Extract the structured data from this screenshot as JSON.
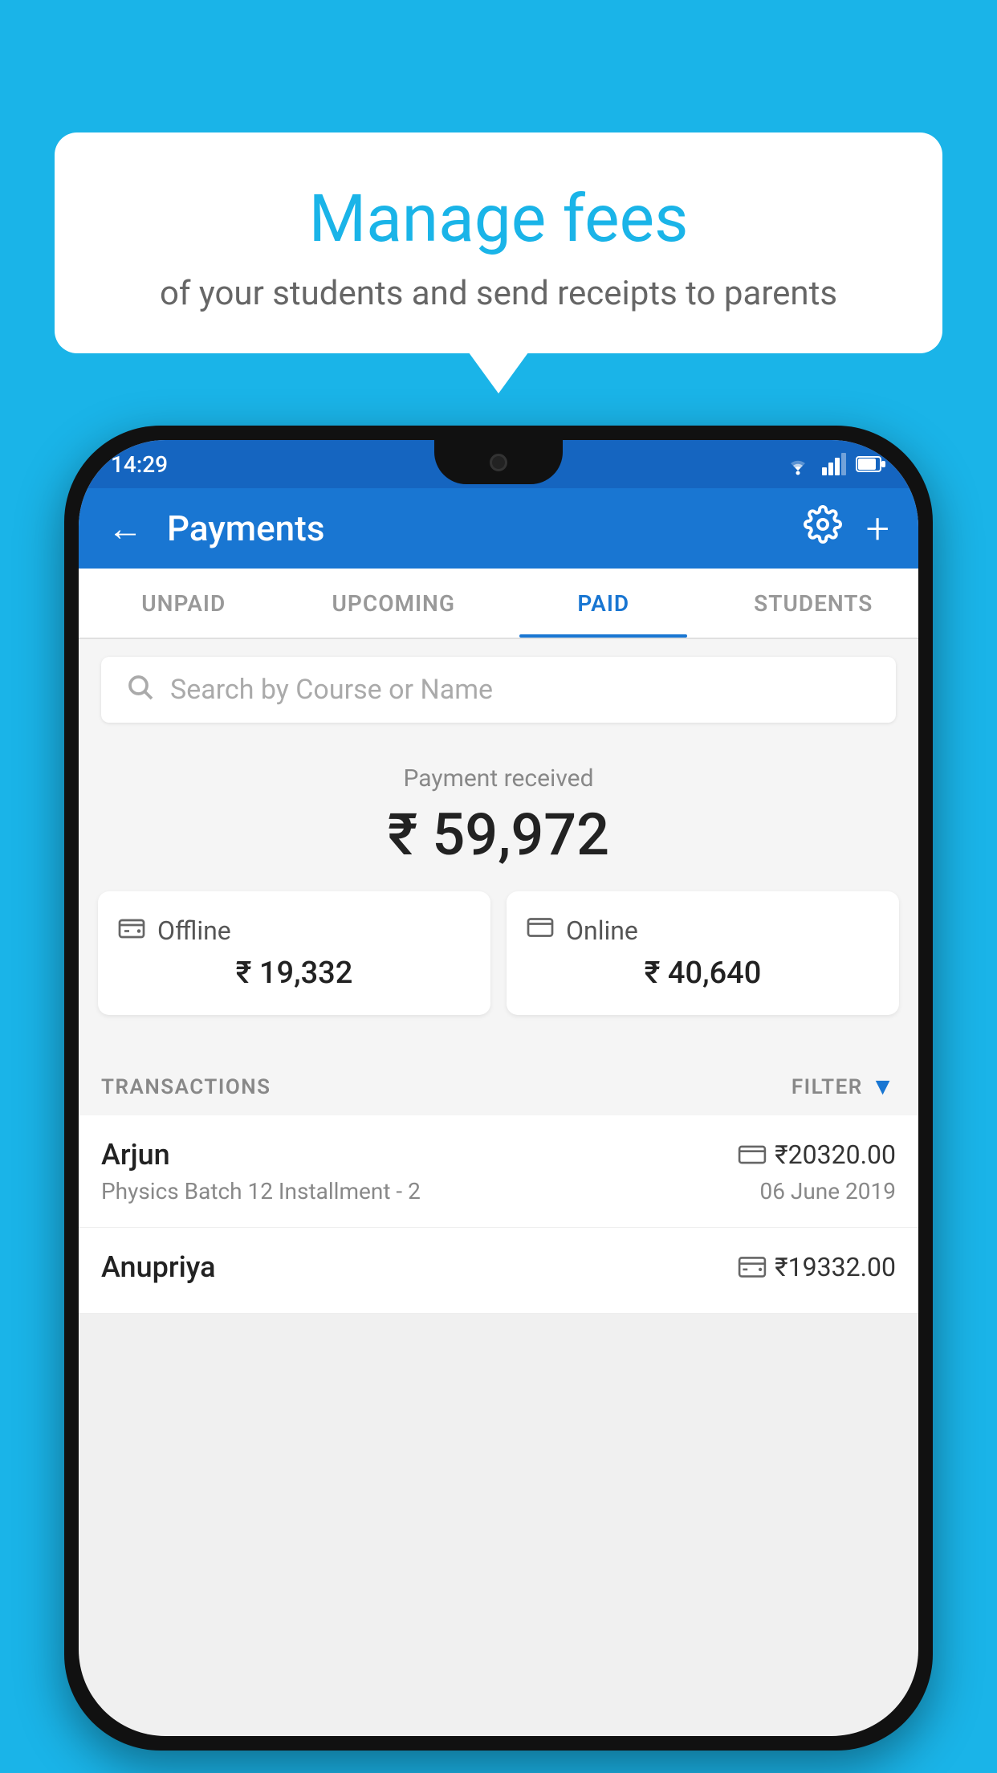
{
  "background_color": "#1ab4e8",
  "bubble": {
    "title": "Manage fees",
    "subtitle": "of your students and send receipts to parents"
  },
  "status_bar": {
    "time": "14:29"
  },
  "app_bar": {
    "title": "Payments",
    "back_label": "←",
    "settings_label": "⚙",
    "add_label": "+"
  },
  "tabs": [
    {
      "label": "UNPAID",
      "active": false
    },
    {
      "label": "UPCOMING",
      "active": false
    },
    {
      "label": "PAID",
      "active": true
    },
    {
      "label": "STUDENTS",
      "active": false
    }
  ],
  "search": {
    "placeholder": "Search by Course or Name"
  },
  "payment": {
    "label": "Payment received",
    "amount": "₹ 59,972",
    "offline_label": "Offline",
    "offline_amount": "₹ 19,332",
    "online_label": "Online",
    "online_amount": "₹ 40,640"
  },
  "transactions": {
    "header_label": "TRANSACTIONS",
    "filter_label": "FILTER",
    "items": [
      {
        "name": "Arjun",
        "course": "Physics Batch 12 Installment - 2",
        "amount": "₹20320.00",
        "date": "06 June 2019",
        "payment_type": "online"
      },
      {
        "name": "Anupriya",
        "course": "",
        "amount": "₹19332.00",
        "date": "",
        "payment_type": "offline"
      }
    ]
  }
}
